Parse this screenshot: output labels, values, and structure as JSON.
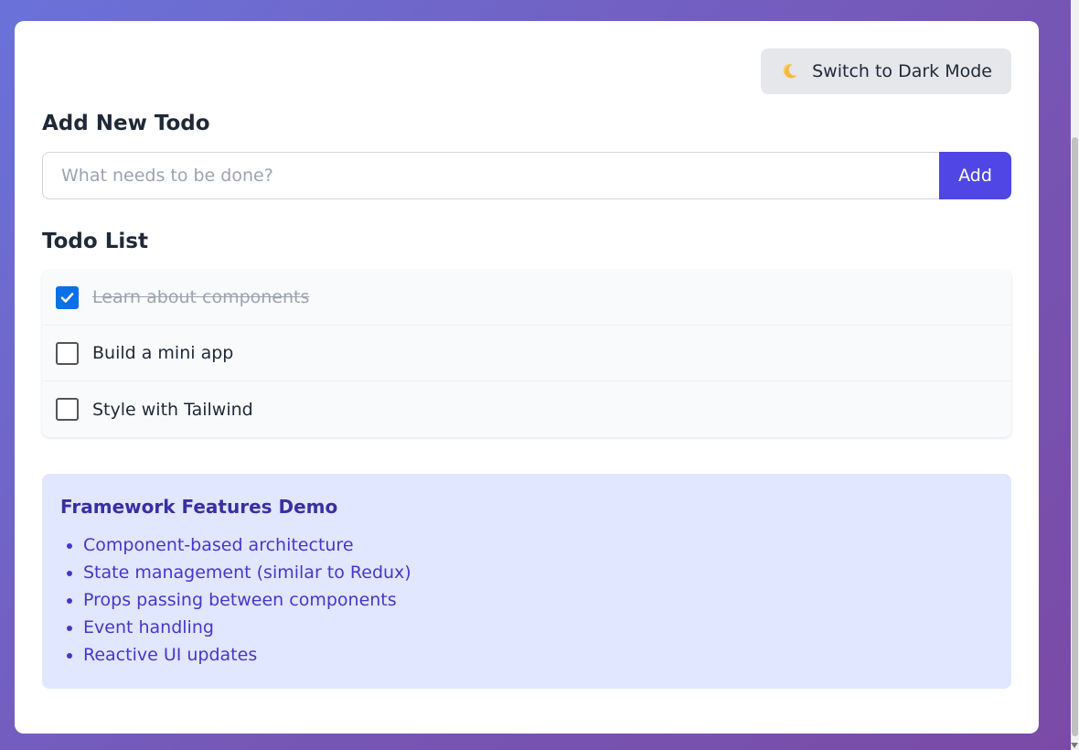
{
  "theme_button": {
    "label": "Switch to Dark Mode",
    "icon": "moon-icon"
  },
  "add_section": {
    "title": "Add New Todo",
    "input_placeholder": "What needs to be done?",
    "input_value": "",
    "add_label": "Add"
  },
  "list_section": {
    "title": "Todo List",
    "items": [
      {
        "text": "Learn about components",
        "completed": true
      },
      {
        "text": "Build a mini app",
        "completed": false
      },
      {
        "text": "Style with Tailwind",
        "completed": false
      }
    ]
  },
  "features": {
    "title": "Framework Features Demo",
    "items": [
      "Component-based architecture",
      "State management (similar to Redux)",
      "Props passing between components",
      "Event handling",
      "Reactive UI updates"
    ]
  },
  "colors": {
    "accent": "#4f46e5",
    "checkbox_checked": "#0b6fe8",
    "features_bg": "#e0e7ff",
    "features_title": "#3730a3",
    "features_text": "#4338ca"
  }
}
